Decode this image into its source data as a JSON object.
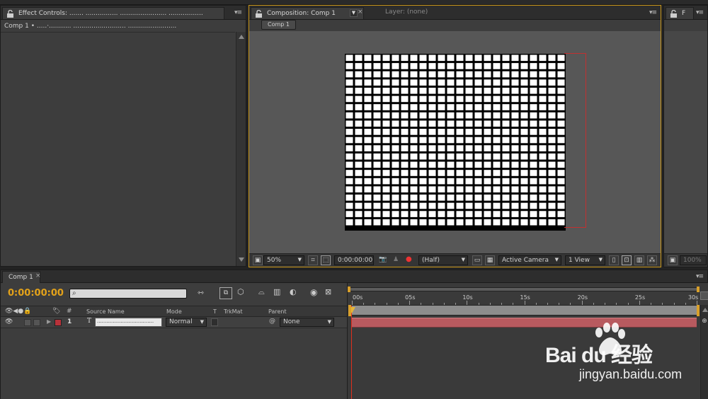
{
  "effect_controls": {
    "tab_label": "Effect Controls: ....... ................ ....................... .................",
    "subheader": "Comp 1 • .....·...........  ..........................   ........................"
  },
  "composition": {
    "tab_label": "Composition: Comp 1",
    "layer_tab_label": "Layer: (none)",
    "comp_button": "Comp 1",
    "grid": {
      "cols": 24,
      "rows": 21
    },
    "footer": {
      "zoom": "50%",
      "timecode": "0:00:00:00",
      "resolution": "(Half)",
      "camera": "Active Camera",
      "views": "1 View"
    }
  },
  "right_panel": {
    "zoom": "100%",
    "tab_glyph": "F"
  },
  "timeline": {
    "tab_label": "Comp 1",
    "current_time": "0:00:00:00",
    "columns": {
      "source_name": "Source Name",
      "mode": "Mode",
      "t": "T",
      "trkmat": "TrkMat",
      "parent": "Parent",
      "number": "#"
    },
    "layers": [
      {
        "number": "1",
        "name": "....................................",
        "mode": "Normal",
        "parent": "None",
        "type_glyph": "T",
        "label_color": "#b8323a"
      }
    ],
    "ruler": [
      "00s",
      "05s",
      "10s",
      "15s",
      "20s",
      "25s",
      "30s"
    ]
  },
  "watermark": {
    "brand": "Bai du 经验",
    "url": "jingyan.baidu.com"
  },
  "colors": {
    "panel": "#3d3d3d",
    "timecode": "#e3a21a",
    "active_border": "#c8961a",
    "layer_bar": "#b85a5f",
    "playhead": "#e0301e"
  }
}
